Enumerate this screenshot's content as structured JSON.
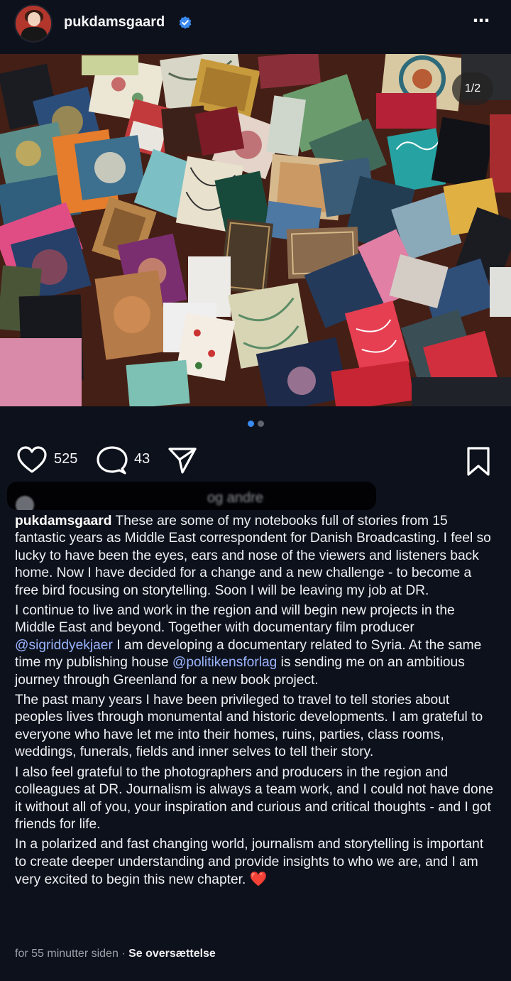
{
  "post": {
    "username": "pukdamsgaard",
    "more_icon": "⋯",
    "image_counter": "1/2",
    "likes": "525",
    "comments": "43",
    "liked_by_text": "og andre",
    "caption_parts": {
      "p1": "These are some of my notebooks full of stories from 15 fantastic years as Middle East correspondent for Danish Broadcasting. I feel so lucky to have been the eyes, ears and nose of the viewers and listeners back home. Now I have decided for a change and a new challenge - to become a free bird focusing on storytelling. Soon I will be leaving my job at DR.",
      "p2_a": "I continue to live and work in the region and will begin new projects in the Middle East and beyond. Together with documentary film producer ",
      "mention1": "@sigriddyekjaer",
      "p2_b": " I am developing a documentary related to Syria. At the same time my publishing house ",
      "mention2": "@politikensforlag",
      "p2_c": " is sending me on an ambitious journey through Greenland for a new book project.",
      "p3": "The past many years I have been privileged to travel to tell stories about peoples lives through monumental and historic developments. I am grateful to everyone who have let me into their homes, ruins, parties, class rooms, weddings, funerals, fields and inner selves to tell their story.",
      "p4": "I also feel grateful to the photographers and producers in the region and colleagues at DR. Journalism is always a team work, and I could not have done it without all of you, your inspiration and curious and critical thoughts - and I got friends for life.",
      "p5": "In a polarized and fast changing world, journalism and storytelling is important to create deeper understanding and provide insights to who we are, and I am very excited to begin this new chapter.",
      "heart": "❤️"
    },
    "timestamp": "for 55 minutter siden",
    "separator": "·",
    "translate_label": "Se oversættelse"
  },
  "colors": {
    "background": "#0d111b",
    "mention": "#9ab4ff",
    "active_dot": "#3a8af0",
    "verified": "#3a8af0"
  },
  "icons": [
    "verified-badge-icon",
    "more-options-icon",
    "heart-icon",
    "comment-icon",
    "share-icon",
    "bookmark-icon"
  ]
}
